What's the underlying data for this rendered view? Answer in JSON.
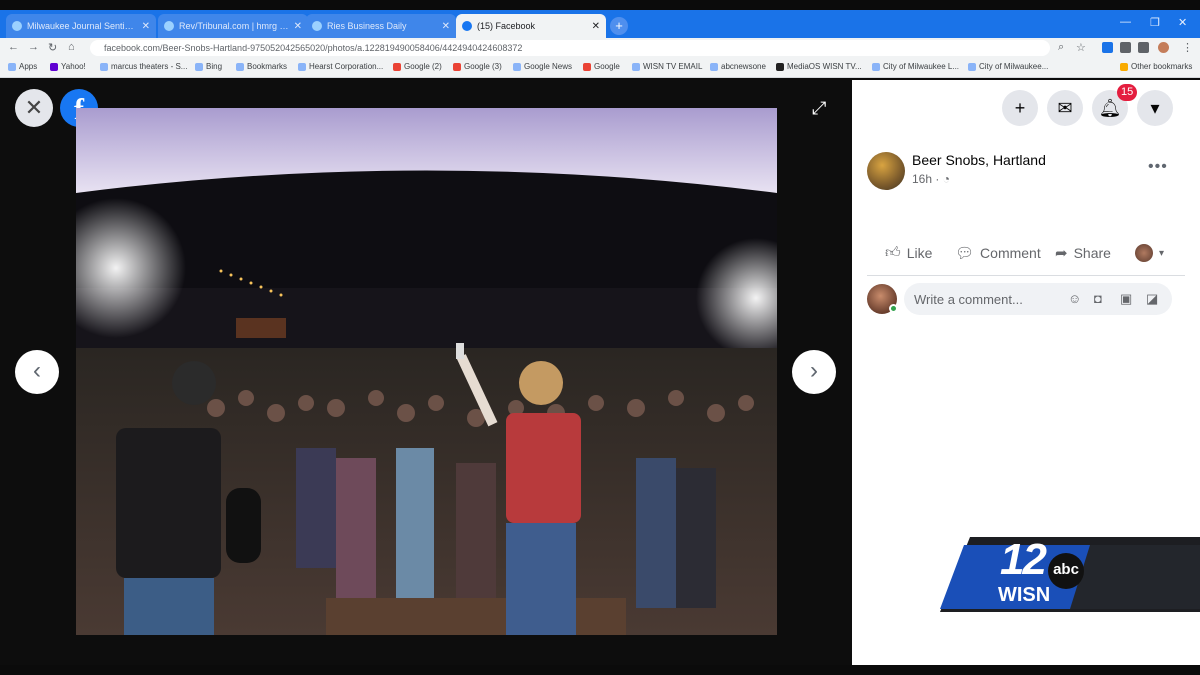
{
  "browser": {
    "tabs": [
      {
        "title": "Milwaukee Journal Sentinel - MJS",
        "active": false
      },
      {
        "title": "Rev/Tribunal.com | hmrg | ...",
        "active": false
      },
      {
        "title": "Ries Business Daily",
        "active": false
      },
      {
        "title": "(15) Facebook",
        "active": true
      }
    ],
    "new_tab_label": "+",
    "url": "facebook.com/Beer-Snobs-Hartland-975052042565020/photos/a.122819490058406/4424940424608372",
    "bookmarks": [
      "Apps",
      "Yahoo!",
      "marcus theaters - S...",
      "Bing",
      "Bookmarks",
      "Hearst Corporation...",
      "Google (2)",
      "Google (3)",
      "Google News",
      "Google",
      "WISN TV EMAIL",
      "abcnewsone",
      "MediaOS WISN TV...",
      "City of Milwaukee L...",
      "City of Milwaukee...",
      "Other bookmarks"
    ]
  },
  "viewer": {
    "close_label": "✕",
    "logo_label": "f",
    "expand_label": "⤢",
    "prev_label": "‹",
    "next_label": "›"
  },
  "panel": {
    "notification_count": "15",
    "post": {
      "author": "Beer Snobs, Hartland",
      "time": "16h ·",
      "more": "•••"
    },
    "actions": {
      "like": "Like",
      "comment": "Comment",
      "share": "Share"
    },
    "comment_placeholder": "Write a comment..."
  },
  "overlay": {
    "station_number": "12",
    "station_name": "WISN",
    "network": "abc"
  },
  "colors": {
    "facebook_blue": "#1877f2",
    "chrome_blue": "#1a73e8",
    "notification_red": "#e41e3f",
    "wisn_blue": "#1a4fb8"
  }
}
